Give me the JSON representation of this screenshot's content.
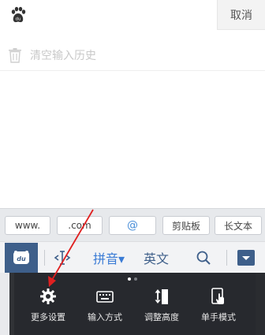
{
  "search_bar": {
    "input_value": "",
    "cancel_label": "取消"
  },
  "history": {
    "clear_label": "清空输入历史"
  },
  "shortcuts": [
    {
      "label": "www."
    },
    {
      "label": ".com"
    },
    {
      "label": "@"
    },
    {
      "label": "剪贴板"
    },
    {
      "label": "长文本"
    }
  ],
  "toolbar": {
    "logo_text": "du",
    "pinyin_label": "拼音▾",
    "english_label": "英文"
  },
  "settings_panel": {
    "items": [
      {
        "label": "更多设置",
        "icon": "gear-icon"
      },
      {
        "label": "输入方式",
        "icon": "keyboard-icon"
      },
      {
        "label": "调整高度",
        "icon": "adjust-height-icon"
      },
      {
        "label": "单手模式",
        "icon": "one-hand-icon"
      }
    ],
    "page_count": 2,
    "current_page": 1
  },
  "colors": {
    "accent_blue": "#3a7bd5",
    "brand_navy": "#3e5f8a",
    "arrow_red": "#e02020"
  }
}
